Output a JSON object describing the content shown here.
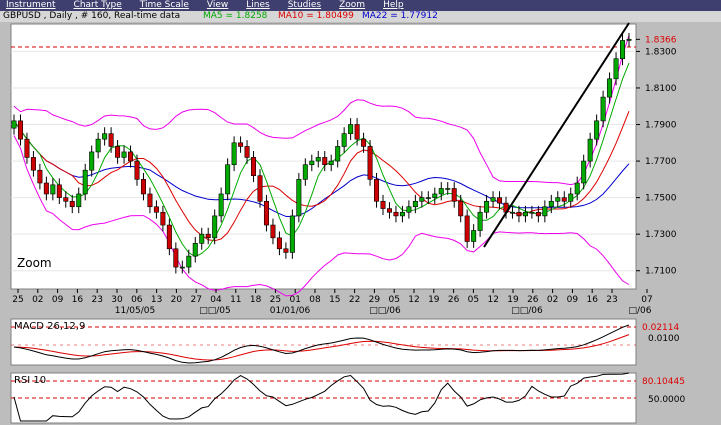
{
  "menu": {
    "items": [
      "Instrument",
      "Chart Type",
      "Time Scale",
      "View",
      "Lines",
      "Studies",
      "Zoom",
      "Help"
    ]
  },
  "header": {
    "symbol_info": "GBPUSD , Daily , # 160, Real-time data",
    "ma5": "MA5 = 1.8258",
    "ma10": "MA10 = 1.80499",
    "ma22": "MA22 = 1.77912"
  },
  "colors": {
    "background": "#bdbdbd",
    "panel": "#ffffff",
    "menubar": "#3f3f6f",
    "candle_up": "#00aa00",
    "candle_down": "#cc0000",
    "ma5": "#00aa00",
    "ma10": "#dd0000",
    "ma22": "#0000cc",
    "bollinger": "#ee00ee",
    "reference_line": "#dd0000"
  },
  "price_panel": {
    "zoom_label": "Zoom",
    "y_labels": [
      "1.8366",
      "1.8300",
      "1.8100",
      "1.7900",
      "1.7700",
      "1.7500",
      "1.7300",
      "1.7100"
    ],
    "x_day_labels": [
      "25",
      "02",
      "09",
      "16",
      "23",
      "30",
      "06",
      "13",
      "20",
      "27",
      "04",
      "11",
      "18",
      "25",
      "01",
      "08",
      "15",
      "22",
      "29",
      "05",
      "12",
      "19",
      "26",
      "05",
      "12",
      "19",
      "26",
      "02",
      "09",
      "16",
      "23",
      "07"
    ],
    "x_month_labels": [
      "11/05/05",
      "□□/05",
      "01/01/06",
      "□□/06",
      "□□/06",
      "□/06"
    ]
  },
  "macd_panel": {
    "title": "MACD 26,12,9",
    "y_labels": [
      "0.02114",
      "0.0100"
    ]
  },
  "rsi_panel": {
    "title": "RSI 10",
    "y_labels": [
      "80.10445",
      "50.0000"
    ]
  },
  "chart_data": {
    "type": "candlestick",
    "instrument": "GBPUSD",
    "interval": "Daily",
    "ylim": [
      1.7,
      1.845
    ],
    "last_close": 1.8366,
    "indicators": [
      {
        "name": "MA5",
        "value": 1.8258
      },
      {
        "name": "MA10",
        "value": 1.80499
      },
      {
        "name": "MA22",
        "value": 1.77912
      },
      {
        "name": "MACD 26,12,9",
        "value": 0.02114
      },
      {
        "name": "RSI 10",
        "value": 80.10445
      }
    ],
    "close_series": [
      1.792,
      1.782,
      1.772,
      1.765,
      1.758,
      1.752,
      1.757,
      1.75,
      1.748,
      1.745,
      1.752,
      1.765,
      1.775,
      1.782,
      1.785,
      1.778,
      1.772,
      1.775,
      1.77,
      1.76,
      1.752,
      1.745,
      1.742,
      1.735,
      1.722,
      1.712,
      1.712,
      1.718,
      1.725,
      1.73,
      1.728,
      1.74,
      1.752,
      1.768,
      1.78,
      1.778,
      1.772,
      1.762,
      1.748,
      1.735,
      1.728,
      1.722,
      1.72,
      1.74,
      1.76,
      1.768,
      1.77,
      1.772,
      1.768,
      1.77,
      1.778,
      1.785,
      1.79,
      1.782,
      1.778,
      1.76,
      1.748,
      1.744,
      1.742,
      1.74,
      1.742,
      1.745,
      1.748,
      1.75,
      1.75,
      1.752,
      1.755,
      1.755,
      1.748,
      1.74,
      1.726,
      1.732,
      1.742,
      1.748,
      1.75,
      1.747,
      1.742,
      1.742,
      1.74,
      1.742,
      1.742,
      1.74,
      1.745,
      1.748,
      1.75,
      1.748,
      1.752,
      1.758,
      1.77,
      1.782,
      1.792,
      1.805,
      1.815,
      1.826,
      1.836,
      1.8366
    ]
  }
}
